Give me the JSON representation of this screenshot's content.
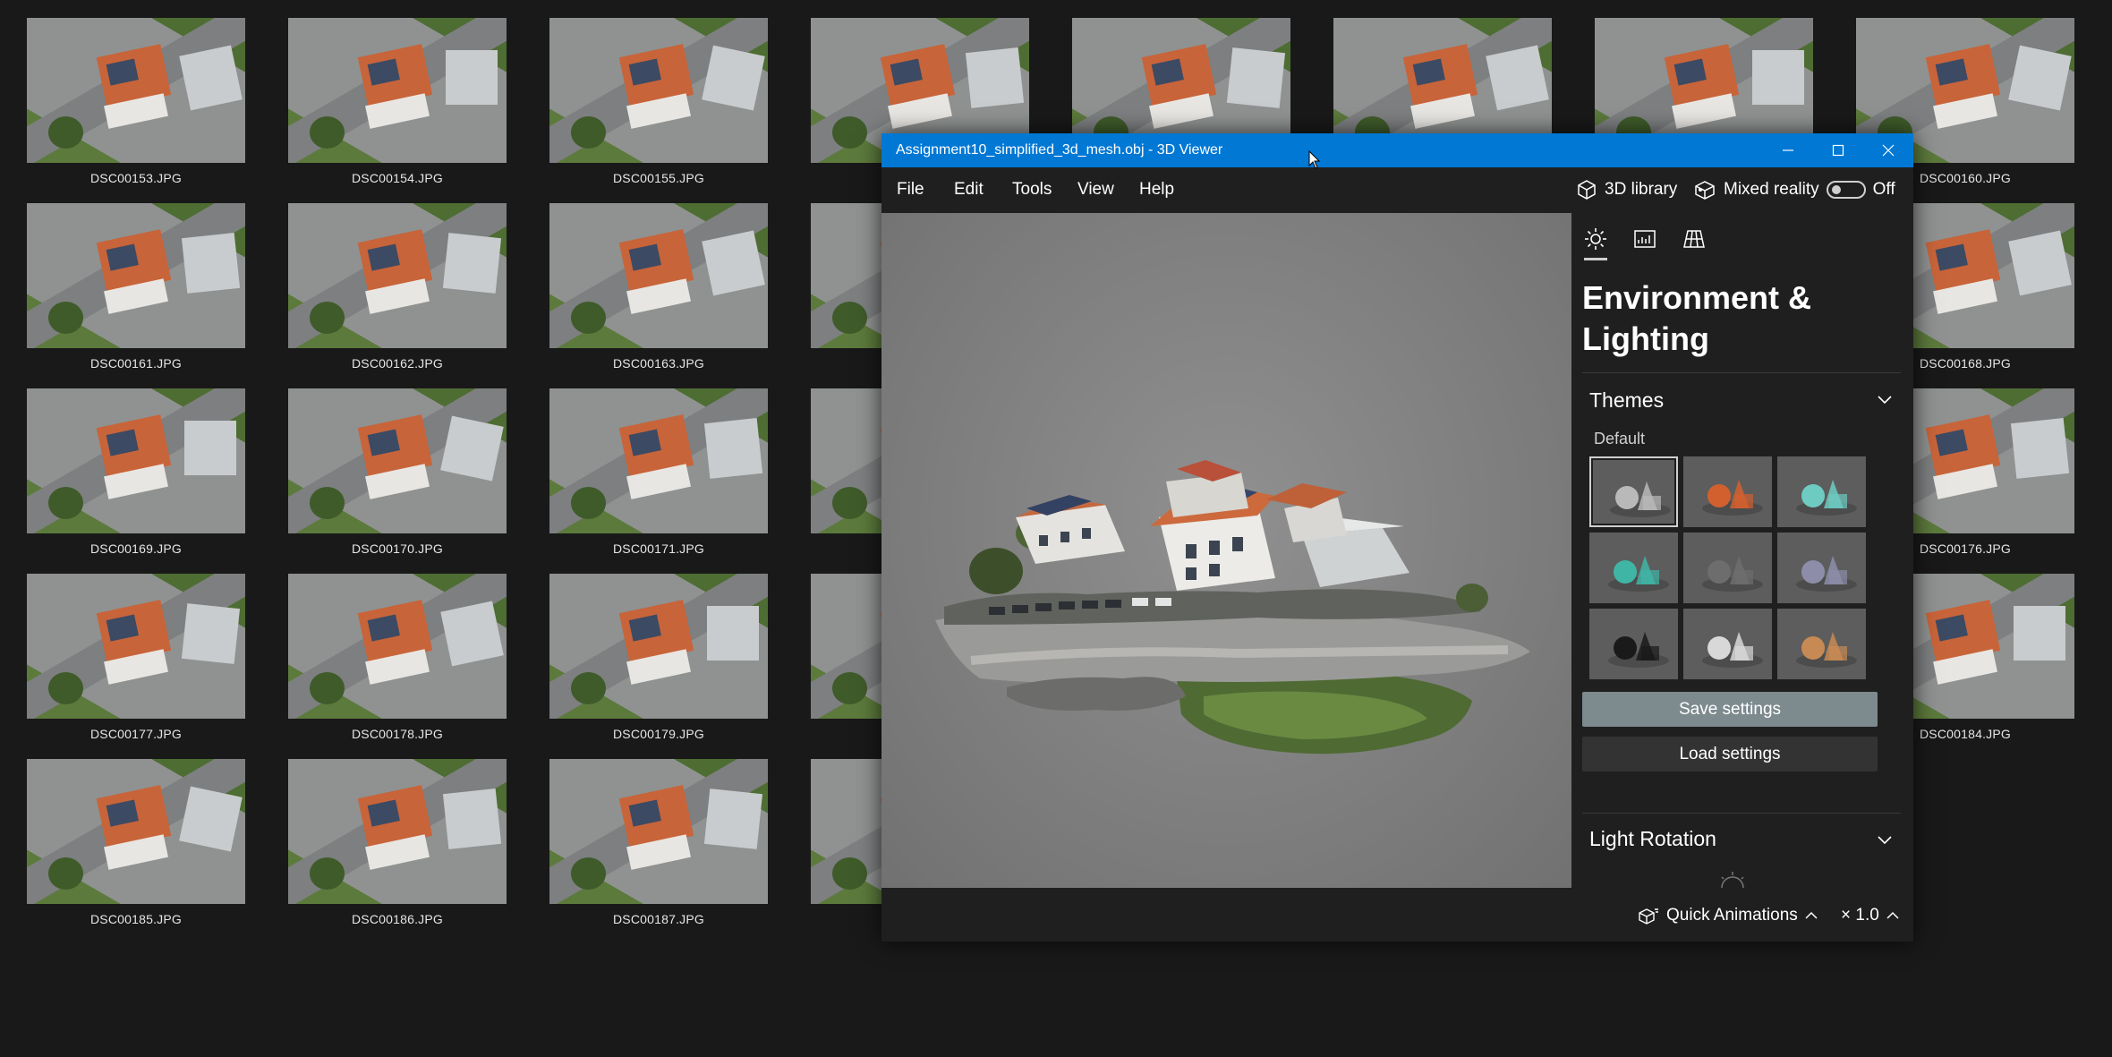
{
  "gallery": {
    "columns": [
      [
        "DSC00153.JPG",
        "DSC00161.JPG",
        "DSC00169.JPG",
        "DSC00177.JPG",
        "DSC00185.JPG"
      ],
      [
        "DSC00154.JPG",
        "DSC00162.JPG",
        "DSC00170.JPG",
        "DSC00178.JPG",
        "DSC00186.JPG"
      ],
      [
        "DSC00155.JPG",
        "DSC00163.JPG",
        "DSC00171.JPG",
        "DSC00179.JPG",
        "DSC00187.JPG"
      ],
      [
        "",
        "",
        "",
        "",
        ""
      ],
      [
        "",
        "",
        "",
        "",
        ""
      ],
      [
        "",
        "",
        "",
        "",
        ""
      ],
      [
        "",
        "",
        "",
        "",
        ""
      ],
      [
        "DSC00160.JPG",
        "DSC00168.JPG",
        "DSC00176.JPG",
        "DSC00184.JPG",
        ""
      ]
    ]
  },
  "window": {
    "title": "Assignment10_simplified_3d_mesh.obj - 3D Viewer",
    "accent_color": "#0078d4"
  },
  "menu": {
    "file": "File",
    "edit": "Edit",
    "tools": "Tools",
    "view": "View",
    "help": "Help"
  },
  "toolbar": {
    "library_label": "3D library",
    "mixed_reality_label": "Mixed reality",
    "mixed_reality_state": "Off"
  },
  "panel": {
    "heading": "Environment & Lighting",
    "themes_title": "Themes",
    "themes_group": "Default",
    "themes": [
      {
        "name": "theme-gray",
        "color": "#b9b9b9",
        "selected": true
      },
      {
        "name": "theme-orange",
        "color": "#d2602f"
      },
      {
        "name": "theme-teal",
        "color": "#6ecbc2"
      },
      {
        "name": "theme-cyan",
        "color": "#3fb5a6"
      },
      {
        "name": "theme-dark-gray",
        "color": "#6d6d6d"
      },
      {
        "name": "theme-lavender",
        "color": "#8d8daa"
      },
      {
        "name": "theme-black",
        "color": "#1a1a1a"
      },
      {
        "name": "theme-white",
        "color": "#d8d8d8"
      },
      {
        "name": "theme-sunset",
        "color": "#c78a54"
      }
    ],
    "save_label": "Save settings",
    "load_label": "Load settings",
    "light_rotation_title": "Light Rotation"
  },
  "status": {
    "animations_label": "Quick Animations",
    "speed_label": "× 1.0"
  }
}
